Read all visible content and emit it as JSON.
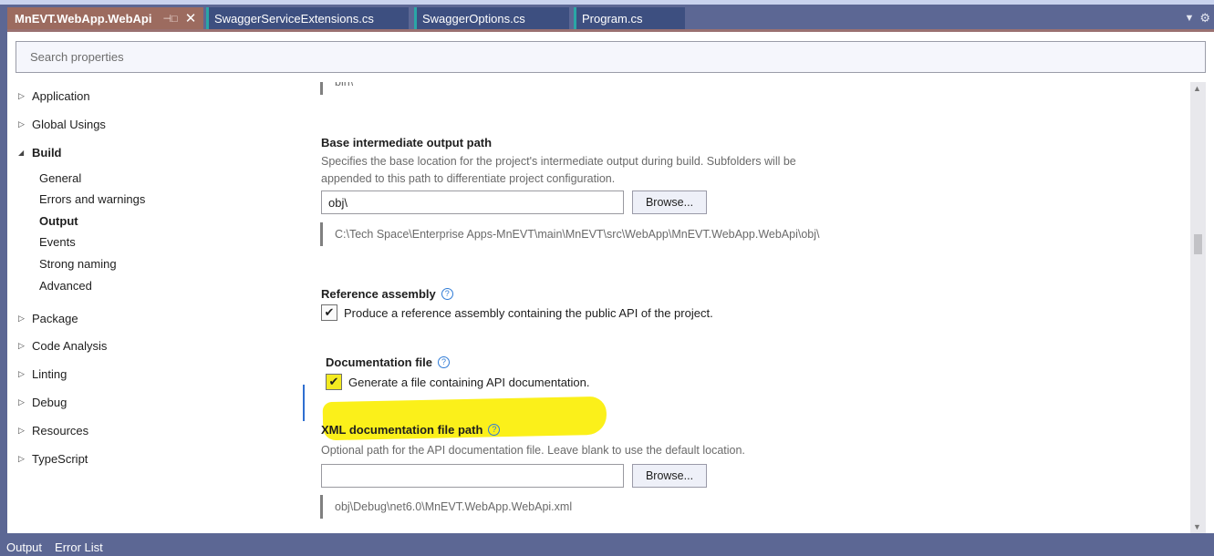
{
  "tabs": [
    {
      "label": "MnEVT.WebApp.WebApi",
      "active": true,
      "pin_icon": "pin-icon",
      "close_icon": "close-icon"
    },
    {
      "label": "SwaggerServiceExtensions.cs",
      "active": false
    },
    {
      "label": "SwaggerOptions.cs",
      "active": false
    },
    {
      "label": "Program.cs",
      "active": false
    }
  ],
  "tab_tools": {
    "dropdown_icon": "chevron-down-icon",
    "settings_icon": "gear-icon"
  },
  "search": {
    "placeholder": "Search properties",
    "value": ""
  },
  "sidebar": {
    "items": [
      {
        "label": "Application",
        "expanded": false
      },
      {
        "label": "Global Usings",
        "expanded": false
      },
      {
        "label": "Build",
        "expanded": true,
        "children": [
          {
            "label": "General"
          },
          {
            "label": "Errors and warnings"
          },
          {
            "label": "Output",
            "selected": true
          },
          {
            "label": "Events"
          },
          {
            "label": "Strong naming"
          },
          {
            "label": "Advanced"
          }
        ]
      },
      {
        "label": "Package",
        "expanded": false
      },
      {
        "label": "Code Analysis",
        "expanded": false
      },
      {
        "label": "Linting",
        "expanded": false
      },
      {
        "label": "Debug",
        "expanded": false
      },
      {
        "label": "Resources",
        "expanded": false
      },
      {
        "label": "TypeScript",
        "expanded": false
      }
    ]
  },
  "content": {
    "prev_resolved_path": "bin\\",
    "base_intermediate": {
      "title": "Base intermediate output path",
      "description": "Specifies the base location for the project's intermediate output during build. Subfolders will be appended to this path to differentiate project configuration.",
      "value": "obj\\",
      "browse_label": "Browse...",
      "resolved_path": "C:\\Tech Space\\Enterprise Apps-MnEVT\\main\\MnEVT\\src\\WebApp\\MnEVT.WebApp.WebApi\\obj\\"
    },
    "reference_assembly": {
      "title": "Reference assembly",
      "help_icon": "?",
      "checkbox_label": "Produce a reference assembly containing the public API of the project.",
      "checked": true,
      "check_glyph": "✔"
    },
    "documentation_file": {
      "title": "Documentation file",
      "help_icon": "?",
      "checkbox_label": "Generate a file containing API documentation.",
      "checked": true,
      "check_glyph": "✔",
      "highlight_color": "#fbf01a"
    },
    "xml_doc_path": {
      "title": "XML documentation file path",
      "help_icon": "?",
      "description": "Optional path for the API documentation file. Leave blank to use the default location.",
      "value": "",
      "browse_label": "Browse...",
      "resolved_path": "obj\\Debug\\net6.0\\MnEVT.WebApp.WebApi.xml"
    }
  },
  "bottom_tabs": [
    "Output",
    "Error List"
  ],
  "colors": {
    "chrome": "#5c6794",
    "active_tab": "#9c6b5f",
    "inactive_tab": "#3d4f80",
    "tab_accent": "#2aa6a6",
    "focus_accent": "#2f6fd0"
  }
}
